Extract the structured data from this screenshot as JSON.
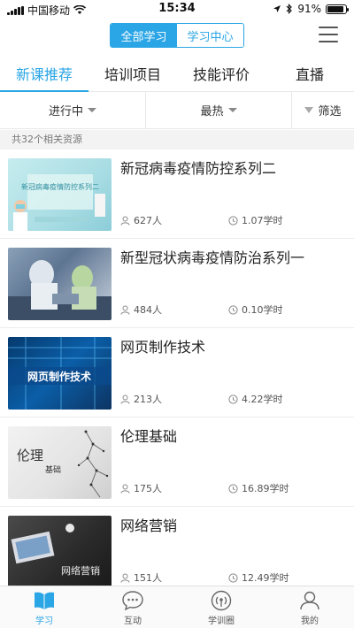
{
  "status_bar": {
    "carrier": "中国移动",
    "time": "15:34",
    "battery": "91%",
    "battery_level": 0.91
  },
  "header": {
    "segments": [
      {
        "label": "全部学习",
        "active": true
      },
      {
        "label": "学习中心",
        "active": false
      }
    ],
    "menu_icon": "hamburger-menu-icon"
  },
  "tabs": [
    {
      "label": "新课推荐",
      "active": true
    },
    {
      "label": "培训项目",
      "active": false
    },
    {
      "label": "技能评价",
      "active": false
    },
    {
      "label": "直播",
      "active": false
    }
  ],
  "filters": {
    "status": "进行中",
    "sort": "最热",
    "filter": "筛选"
  },
  "result_count": "共32个相关资源",
  "courses": [
    {
      "title": "新冠病毒疫情防控系列二",
      "thumb_text": "新冠病毒疫情防控系列二",
      "learners": "627人",
      "hours": "1.07学时"
    },
    {
      "title": "新型冠状病毒疫情防治系列一",
      "thumb_text": "",
      "learners": "484人",
      "hours": "0.10学时"
    },
    {
      "title": "网页制作技术",
      "thumb_text": "网页制作技术",
      "learners": "213人",
      "hours": "4.22学时"
    },
    {
      "title": "伦理基础",
      "thumb_text": "伦理",
      "thumb_subtext": "基础",
      "learners": "175人",
      "hours": "16.89学时"
    },
    {
      "title": "网络营销",
      "thumb_text": "网络营销",
      "learners": "151人",
      "hours": "12.49学时"
    }
  ],
  "bottom_nav": [
    {
      "label": "学习",
      "icon": "book-icon",
      "active": true
    },
    {
      "label": "互动",
      "icon": "chat-bubble-icon",
      "active": false
    },
    {
      "label": "学训圈",
      "icon": "broadcast-icon",
      "active": false
    },
    {
      "label": "我的",
      "icon": "user-icon",
      "active": false
    }
  ],
  "colors": {
    "accent": "#2aa5e5"
  }
}
